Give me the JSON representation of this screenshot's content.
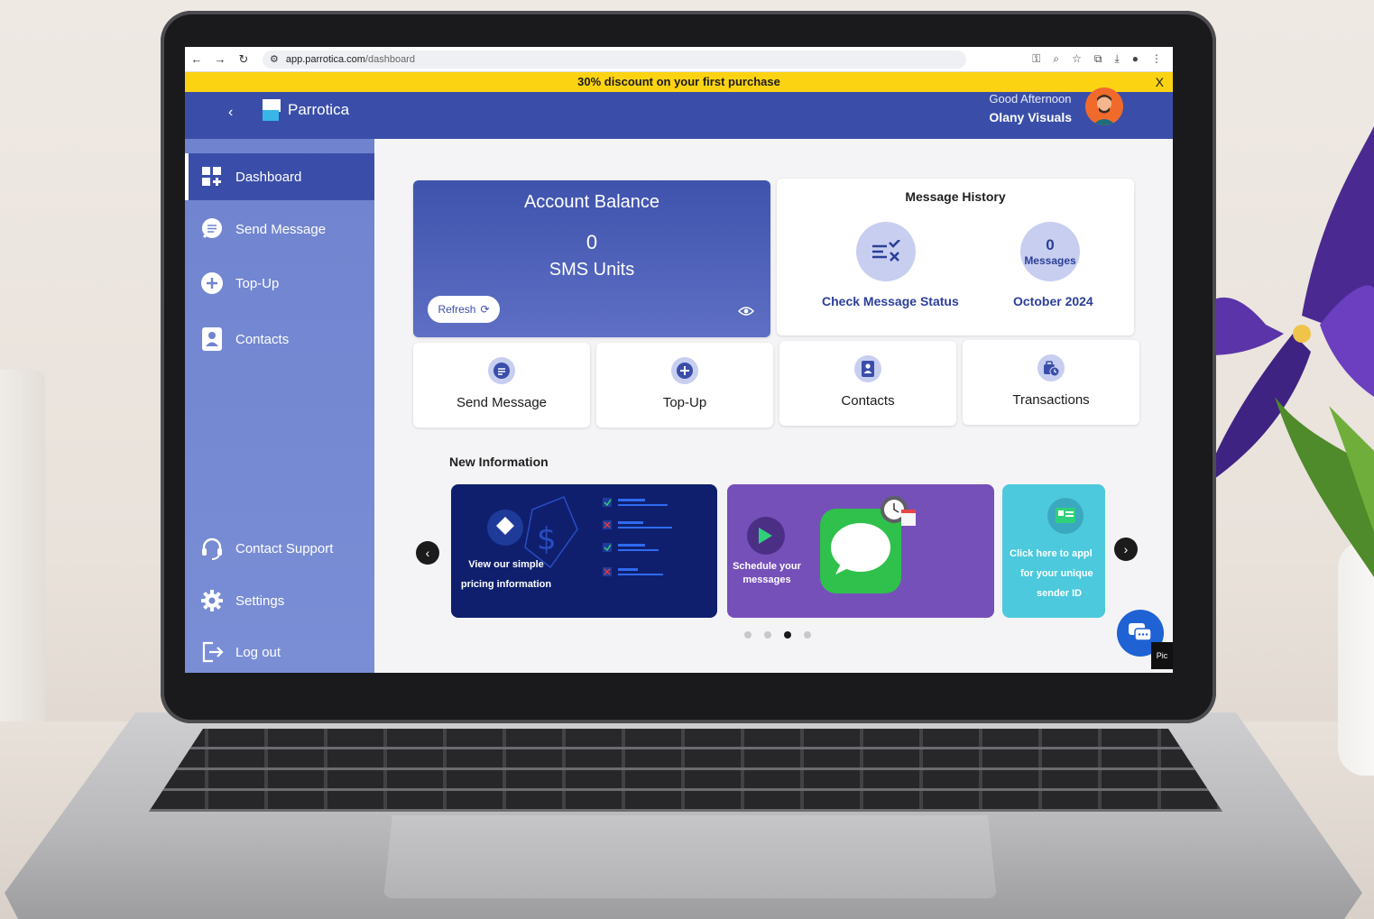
{
  "browser": {
    "url_host": "app.parrotica.com",
    "url_path": "/dashboard"
  },
  "promo": {
    "text": "30% discount on your first purchase",
    "close_label": "X"
  },
  "header": {
    "app_name": "Parrotica",
    "greeting": "Good Afternoon",
    "user_name": "Olany Visuals"
  },
  "sidebar": {
    "items": [
      {
        "label": "Dashboard",
        "icon": "dashboard-icon"
      },
      {
        "label": "Send Message",
        "icon": "message-icon"
      },
      {
        "label": "Top-Up",
        "icon": "plus-circle-icon"
      },
      {
        "label": "Contacts",
        "icon": "contact-book-icon"
      }
    ],
    "bottom_items": [
      {
        "label": "Contact Support",
        "icon": "headset-icon"
      },
      {
        "label": "Settings",
        "icon": "gear-icon"
      },
      {
        "label": "Log out",
        "icon": "logout-icon"
      }
    ]
  },
  "balance": {
    "title": "Account Balance",
    "value": "0",
    "unit_label": "SMS Units",
    "refresh_label": "Refresh"
  },
  "message_history": {
    "title": "Message History",
    "check_label": "Check Message Status",
    "count_value": "0",
    "count_unit": "Messages",
    "month_label": "October 2024"
  },
  "actions": [
    {
      "label": "Send Message",
      "icon": "message-icon"
    },
    {
      "label": "Top-Up",
      "icon": "plus-circle-icon"
    },
    {
      "label": "Contacts",
      "icon": "contact-book-icon"
    },
    {
      "label": "Transactions",
      "icon": "transactions-icon"
    }
  ],
  "new_information": {
    "title": "New Information",
    "slides": [
      {
        "line1": "View our simple",
        "line2": "pricing information"
      },
      {
        "line1": "Schedule your",
        "line2": "messages"
      },
      {
        "line1": "Click here to appl",
        "line2": "for your unique",
        "line3": "sender ID"
      }
    ],
    "active_dot": 3,
    "dot_count": 4
  },
  "chat": {
    "badge_label": "Pic"
  },
  "colors": {
    "primary": "#3a4ea9",
    "sidebar": "#7a8ed6",
    "promo": "#fcd312",
    "accent_text": "#2b3f98",
    "slide_navy": "#0f1f6e",
    "slide_purple": "#7650b9",
    "slide_teal": "#4cc9dc",
    "chat_blue": "#1f62d4"
  }
}
